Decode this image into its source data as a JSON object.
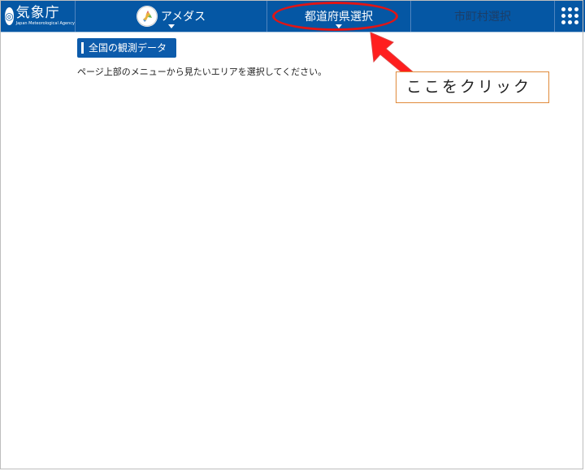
{
  "header": {
    "logo_jp": "気象庁",
    "logo_en": "Japan Meteorological Agency",
    "nav_amedas": "アメダス",
    "nav_prefecture": "都道府県選択",
    "nav_city": "市町村選択"
  },
  "main": {
    "section_label": "全国の観測データ",
    "instruction": "ページ上部のメニューから見たいエリアを選択してください。"
  },
  "annotation": {
    "callout": "ここをクリック"
  },
  "colors": {
    "navbar": "#0557a4",
    "badge": "#0c5bab",
    "highlight": "#e01515",
    "callout_border": "#e08a3b"
  }
}
